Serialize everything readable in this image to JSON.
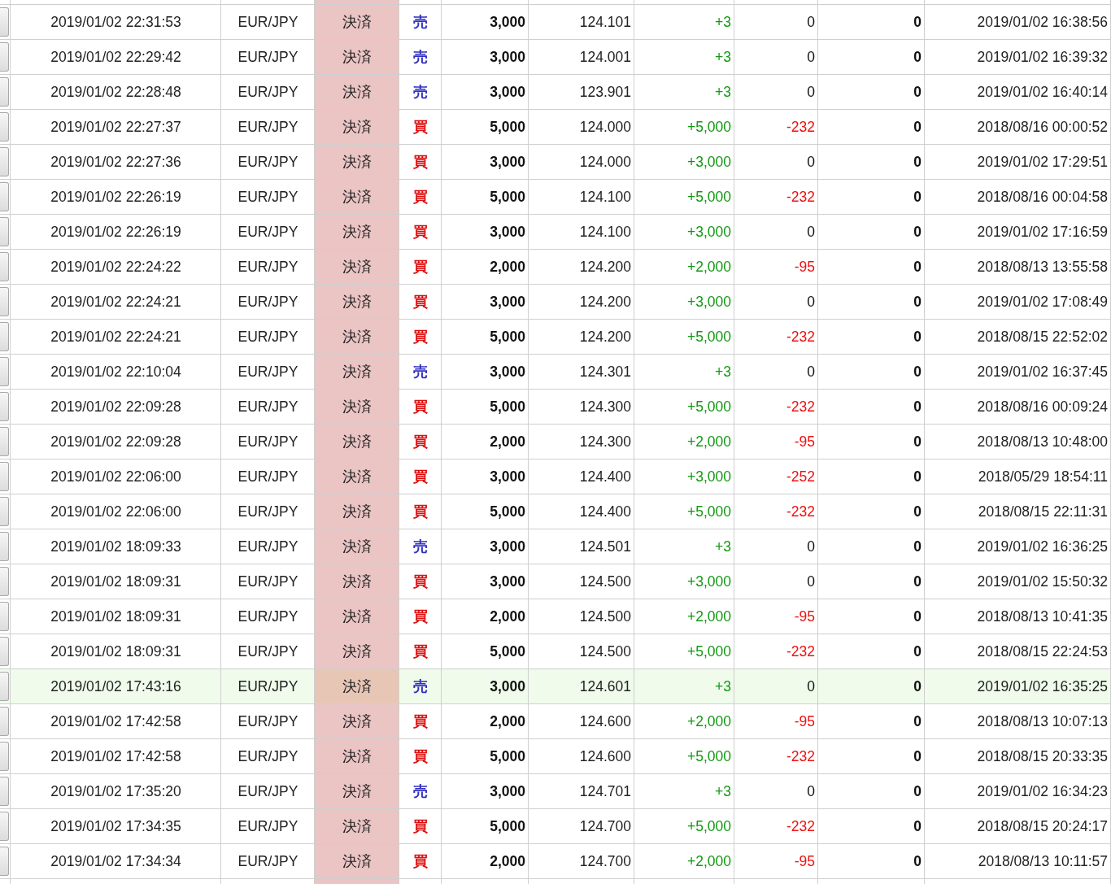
{
  "table": {
    "rows": [
      {
        "selected": false,
        "column_1": "2019/01/02 22:31:53",
        "column_2": "EUR/JPY",
        "column_3": "決済",
        "column_4": {
          "label": "売",
          "color": "#3030c0"
        },
        "column_5": "3,000",
        "column_6": "124.101",
        "column_7": {
          "text": "+3",
          "color": "#119911"
        },
        "column_8": {
          "text": "0",
          "color": "#111111"
        },
        "column_9": "0",
        "column_10": "2019/01/02 16:38:56"
      },
      {
        "selected": false,
        "column_1": "2019/01/02 22:29:42",
        "column_2": "EUR/JPY",
        "column_3": "決済",
        "column_4": {
          "label": "売",
          "color": "#3030c0"
        },
        "column_5": "3,000",
        "column_6": "124.001",
        "column_7": {
          "text": "+3",
          "color": "#119911"
        },
        "column_8": {
          "text": "0",
          "color": "#111111"
        },
        "column_9": "0",
        "column_10": "2019/01/02 16:39:32"
      },
      {
        "selected": false,
        "column_1": "2019/01/02 22:28:48",
        "column_2": "EUR/JPY",
        "column_3": "決済",
        "column_4": {
          "label": "売",
          "color": "#3030c0"
        },
        "column_5": "3,000",
        "column_6": "123.901",
        "column_7": {
          "text": "+3",
          "color": "#119911"
        },
        "column_8": {
          "text": "0",
          "color": "#111111"
        },
        "column_9": "0",
        "column_10": "2019/01/02 16:40:14"
      },
      {
        "selected": false,
        "column_1": "2019/01/02 22:27:37",
        "column_2": "EUR/JPY",
        "column_3": "決済",
        "column_4": {
          "label": "買",
          "color": "#dd1111"
        },
        "column_5": "5,000",
        "column_6": "124.000",
        "column_7": {
          "text": "+5,000",
          "color": "#119911"
        },
        "column_8": {
          "text": "-232",
          "color": "#ee1111"
        },
        "column_9": "0",
        "column_10": "2018/08/16 00:00:52"
      },
      {
        "selected": false,
        "column_1": "2019/01/02 22:27:36",
        "column_2": "EUR/JPY",
        "column_3": "決済",
        "column_4": {
          "label": "買",
          "color": "#dd1111"
        },
        "column_5": "3,000",
        "column_6": "124.000",
        "column_7": {
          "text": "+3,000",
          "color": "#119911"
        },
        "column_8": {
          "text": "0",
          "color": "#111111"
        },
        "column_9": "0",
        "column_10": "2019/01/02 17:29:51"
      },
      {
        "selected": false,
        "column_1": "2019/01/02 22:26:19",
        "column_2": "EUR/JPY",
        "column_3": "決済",
        "column_4": {
          "label": "買",
          "color": "#dd1111"
        },
        "column_5": "5,000",
        "column_6": "124.100",
        "column_7": {
          "text": "+5,000",
          "color": "#119911"
        },
        "column_8": {
          "text": "-232",
          "color": "#ee1111"
        },
        "column_9": "0",
        "column_10": "2018/08/16 00:04:58"
      },
      {
        "selected": false,
        "column_1": "2019/01/02 22:26:19",
        "column_2": "EUR/JPY",
        "column_3": "決済",
        "column_4": {
          "label": "買",
          "color": "#dd1111"
        },
        "column_5": "3,000",
        "column_6": "124.100",
        "column_7": {
          "text": "+3,000",
          "color": "#119911"
        },
        "column_8": {
          "text": "0",
          "color": "#111111"
        },
        "column_9": "0",
        "column_10": "2019/01/02 17:16:59"
      },
      {
        "selected": false,
        "column_1": "2019/01/02 22:24:22",
        "column_2": "EUR/JPY",
        "column_3": "決済",
        "column_4": {
          "label": "買",
          "color": "#dd1111"
        },
        "column_5": "2,000",
        "column_6": "124.200",
        "column_7": {
          "text": "+2,000",
          "color": "#119911"
        },
        "column_8": {
          "text": "-95",
          "color": "#ee1111"
        },
        "column_9": "0",
        "column_10": "2018/08/13 13:55:58"
      },
      {
        "selected": false,
        "column_1": "2019/01/02 22:24:21",
        "column_2": "EUR/JPY",
        "column_3": "決済",
        "column_4": {
          "label": "買",
          "color": "#dd1111"
        },
        "column_5": "3,000",
        "column_6": "124.200",
        "column_7": {
          "text": "+3,000",
          "color": "#119911"
        },
        "column_8": {
          "text": "0",
          "color": "#111111"
        },
        "column_9": "0",
        "column_10": "2019/01/02 17:08:49"
      },
      {
        "selected": false,
        "column_1": "2019/01/02 22:24:21",
        "column_2": "EUR/JPY",
        "column_3": "決済",
        "column_4": {
          "label": "買",
          "color": "#dd1111"
        },
        "column_5": "5,000",
        "column_6": "124.200",
        "column_7": {
          "text": "+5,000",
          "color": "#119911"
        },
        "column_8": {
          "text": "-232",
          "color": "#ee1111"
        },
        "column_9": "0",
        "column_10": "2018/08/15 22:52:02"
      },
      {
        "selected": false,
        "column_1": "2019/01/02 22:10:04",
        "column_2": "EUR/JPY",
        "column_3": "決済",
        "column_4": {
          "label": "売",
          "color": "#3030c0"
        },
        "column_5": "3,000",
        "column_6": "124.301",
        "column_7": {
          "text": "+3",
          "color": "#119911"
        },
        "column_8": {
          "text": "0",
          "color": "#111111"
        },
        "column_9": "0",
        "column_10": "2019/01/02 16:37:45"
      },
      {
        "selected": false,
        "column_1": "2019/01/02 22:09:28",
        "column_2": "EUR/JPY",
        "column_3": "決済",
        "column_4": {
          "label": "買",
          "color": "#dd1111"
        },
        "column_5": "5,000",
        "column_6": "124.300",
        "column_7": {
          "text": "+5,000",
          "color": "#119911"
        },
        "column_8": {
          "text": "-232",
          "color": "#ee1111"
        },
        "column_9": "0",
        "column_10": "2018/08/16 00:09:24"
      },
      {
        "selected": false,
        "column_1": "2019/01/02 22:09:28",
        "column_2": "EUR/JPY",
        "column_3": "決済",
        "column_4": {
          "label": "買",
          "color": "#dd1111"
        },
        "column_5": "2,000",
        "column_6": "124.300",
        "column_7": {
          "text": "+2,000",
          "color": "#119911"
        },
        "column_8": {
          "text": "-95",
          "color": "#ee1111"
        },
        "column_9": "0",
        "column_10": "2018/08/13 10:48:00"
      },
      {
        "selected": false,
        "column_1": "2019/01/02 22:06:00",
        "column_2": "EUR/JPY",
        "column_3": "決済",
        "column_4": {
          "label": "買",
          "color": "#dd1111"
        },
        "column_5": "3,000",
        "column_6": "124.400",
        "column_7": {
          "text": "+3,000",
          "color": "#119911"
        },
        "column_8": {
          "text": "-252",
          "color": "#ee1111"
        },
        "column_9": "0",
        "column_10": "2018/05/29 18:54:11"
      },
      {
        "selected": false,
        "column_1": "2019/01/02 22:06:00",
        "column_2": "EUR/JPY",
        "column_3": "決済",
        "column_4": {
          "label": "買",
          "color": "#dd1111"
        },
        "column_5": "5,000",
        "column_6": "124.400",
        "column_7": {
          "text": "+5,000",
          "color": "#119911"
        },
        "column_8": {
          "text": "-232",
          "color": "#ee1111"
        },
        "column_9": "0",
        "column_10": "2018/08/15 22:11:31"
      },
      {
        "selected": false,
        "column_1": "2019/01/02 18:09:33",
        "column_2": "EUR/JPY",
        "column_3": "決済",
        "column_4": {
          "label": "売",
          "color": "#3030c0"
        },
        "column_5": "3,000",
        "column_6": "124.501",
        "column_7": {
          "text": "+3",
          "color": "#119911"
        },
        "column_8": {
          "text": "0",
          "color": "#111111"
        },
        "column_9": "0",
        "column_10": "2019/01/02 16:36:25"
      },
      {
        "selected": false,
        "column_1": "2019/01/02 18:09:31",
        "column_2": "EUR/JPY",
        "column_3": "決済",
        "column_4": {
          "label": "買",
          "color": "#dd1111"
        },
        "column_5": "3,000",
        "column_6": "124.500",
        "column_7": {
          "text": "+3,000",
          "color": "#119911"
        },
        "column_8": {
          "text": "0",
          "color": "#111111"
        },
        "column_9": "0",
        "column_10": "2019/01/02 15:50:32"
      },
      {
        "selected": false,
        "column_1": "2019/01/02 18:09:31",
        "column_2": "EUR/JPY",
        "column_3": "決済",
        "column_4": {
          "label": "買",
          "color": "#dd1111"
        },
        "column_5": "2,000",
        "column_6": "124.500",
        "column_7": {
          "text": "+2,000",
          "color": "#119911"
        },
        "column_8": {
          "text": "-95",
          "color": "#ee1111"
        },
        "column_9": "0",
        "column_10": "2018/08/13 10:41:35"
      },
      {
        "selected": false,
        "column_1": "2019/01/02 18:09:31",
        "column_2": "EUR/JPY",
        "column_3": "決済",
        "column_4": {
          "label": "買",
          "color": "#dd1111"
        },
        "column_5": "5,000",
        "column_6": "124.500",
        "column_7": {
          "text": "+5,000",
          "color": "#119911"
        },
        "column_8": {
          "text": "-232",
          "color": "#ee1111"
        },
        "column_9": "0",
        "column_10": "2018/08/15 22:24:53"
      },
      {
        "selected": true,
        "column_1": "2019/01/02 17:43:16",
        "column_2": "EUR/JPY",
        "column_3": "決済",
        "column_4": {
          "label": "売",
          "color": "#3030c0"
        },
        "column_5": "3,000",
        "column_6": "124.601",
        "column_7": {
          "text": "+3",
          "color": "#119911"
        },
        "column_8": {
          "text": "0",
          "color": "#111111"
        },
        "column_9": "0",
        "column_10": "2019/01/02 16:35:25"
      },
      {
        "selected": false,
        "column_1": "2019/01/02 17:42:58",
        "column_2": "EUR/JPY",
        "column_3": "決済",
        "column_4": {
          "label": "買",
          "color": "#dd1111"
        },
        "column_5": "2,000",
        "column_6": "124.600",
        "column_7": {
          "text": "+2,000",
          "color": "#119911"
        },
        "column_8": {
          "text": "-95",
          "color": "#ee1111"
        },
        "column_9": "0",
        "column_10": "2018/08/13 10:07:13"
      },
      {
        "selected": false,
        "column_1": "2019/01/02 17:42:58",
        "column_2": "EUR/JPY",
        "column_3": "決済",
        "column_4": {
          "label": "買",
          "color": "#dd1111"
        },
        "column_5": "5,000",
        "column_6": "124.600",
        "column_7": {
          "text": "+5,000",
          "color": "#119911"
        },
        "column_8": {
          "text": "-232",
          "color": "#ee1111"
        },
        "column_9": "0",
        "column_10": "2018/08/15 20:33:35"
      },
      {
        "selected": false,
        "column_1": "2019/01/02 17:35:20",
        "column_2": "EUR/JPY",
        "column_3": "決済",
        "column_4": {
          "label": "売",
          "color": "#3030c0"
        },
        "column_5": "3,000",
        "column_6": "124.701",
        "column_7": {
          "text": "+3",
          "color": "#119911"
        },
        "column_8": {
          "text": "0",
          "color": "#111111"
        },
        "column_9": "0",
        "column_10": "2019/01/02 16:34:23"
      },
      {
        "selected": false,
        "column_1": "2019/01/02 17:34:35",
        "column_2": "EUR/JPY",
        "column_3": "決済",
        "column_4": {
          "label": "買",
          "color": "#dd1111"
        },
        "column_5": "5,000",
        "column_6": "124.700",
        "column_7": {
          "text": "+5,000",
          "color": "#119911"
        },
        "column_8": {
          "text": "-232",
          "color": "#ee1111"
        },
        "column_9": "0",
        "column_10": "2018/08/15 20:24:17"
      },
      {
        "selected": false,
        "column_1": "2019/01/02 17:34:34",
        "column_2": "EUR/JPY",
        "column_3": "決済",
        "column_4": {
          "label": "買",
          "color": "#dd1111"
        },
        "column_5": "2,000",
        "column_6": "124.700",
        "column_7": {
          "text": "+2,000",
          "color": "#119911"
        },
        "column_8": {
          "text": "-95",
          "color": "#ee1111"
        },
        "column_9": "0",
        "column_10": "2018/08/13 10:11:57"
      }
    ]
  }
}
